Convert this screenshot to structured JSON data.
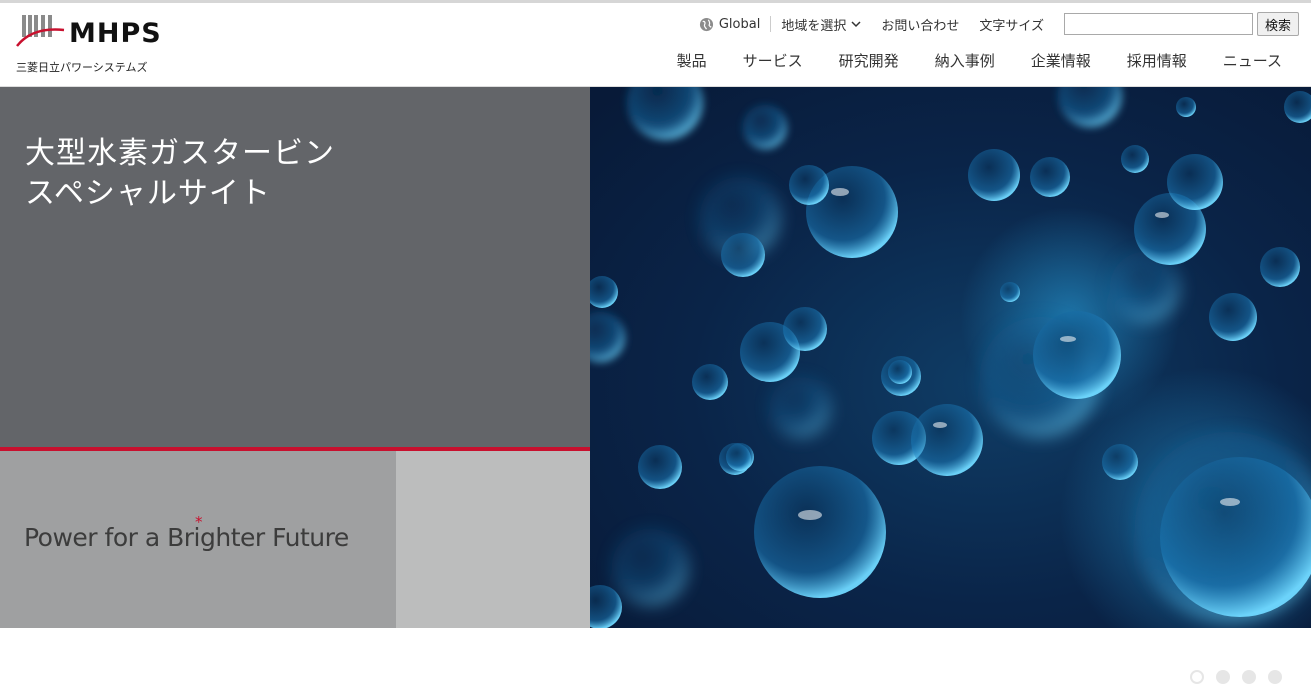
{
  "brand": {
    "logo_text": "MHPS",
    "company_name": "三菱日立パワーシステムズ",
    "accent_color": "#c8102e"
  },
  "utility": {
    "global_label": "Global",
    "global_icon": "globe-icon",
    "region_label": "地域を選択",
    "region_icon": "chevron-down-icon",
    "contact_label": "お問い合わせ",
    "font_size_label": "文字サイズ",
    "search_placeholder": "",
    "search_button": "検索"
  },
  "nav": {
    "items": [
      {
        "label": "製品"
      },
      {
        "label": "サービス"
      },
      {
        "label": "研究開発"
      },
      {
        "label": "納入事例"
      },
      {
        "label": "企業情報"
      },
      {
        "label": "採用情報"
      },
      {
        "label": "ニュース"
      }
    ]
  },
  "hero": {
    "title_line1": "大型水素ガスタービン",
    "title_line2": "スペシャルサイト",
    "tagline": "Power for a Brighter Future",
    "image_subject": "water-bubbles-image",
    "carousel": {
      "count": 4,
      "active_index": 1
    }
  }
}
